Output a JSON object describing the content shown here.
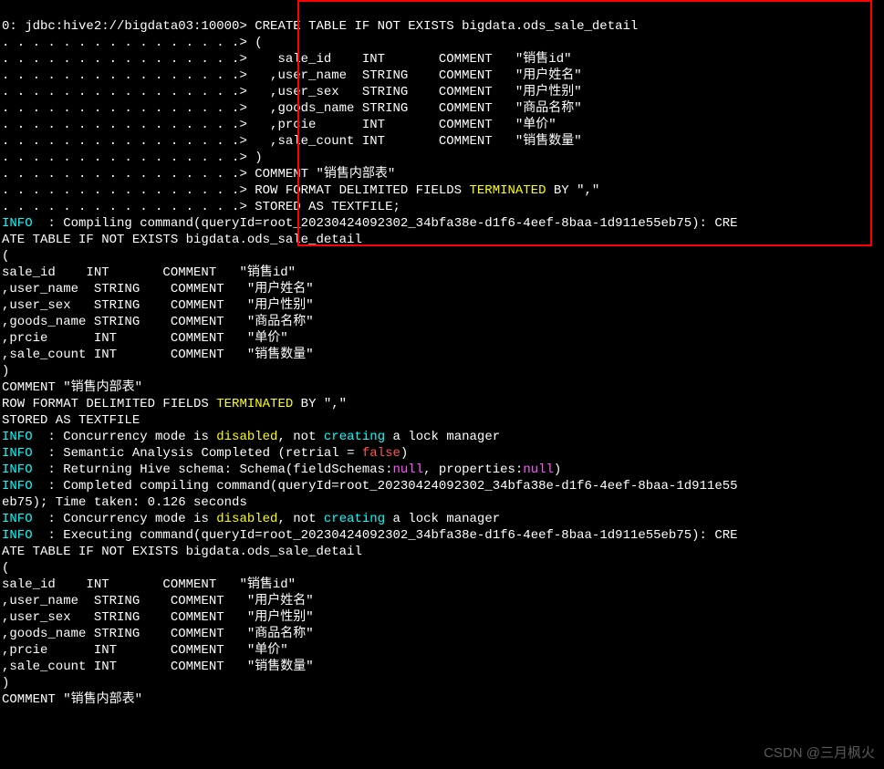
{
  "prompt": "0: jdbc:hive2://bigdata03:10000>",
  "cont": ". . . . . . . . . . . . . . . .>",
  "sql": {
    "line1": " CREATE TABLE IF NOT EXISTS bigdata.ods_sale_detail",
    "line2": " (",
    "line3": "    sale_id    INT       COMMENT   \"销售id\"",
    "line4": "   ,user_name  STRING    COMMENT   \"用户姓名\"",
    "line5": "   ,user_sex   STRING    COMMENT   \"用户性别\"",
    "line6": "   ,goods_name STRING    COMMENT   \"商品名称\"",
    "line7": "   ,prcie      INT       COMMENT   \"单价\"",
    "line8": "   ,sale_count INT       COMMENT   \"销售数量\"",
    "line9": " )",
    "line10": " COMMENT \"销售内部表\"",
    "line11a": " ROW FORMAT DELIMITED FIELDS ",
    "line11b": "TERMINATED",
    "line11c": " BY \",\"",
    "line12": " STORED AS TEXTFILE;"
  },
  "body": {
    "paren_open": "(",
    "col1": "sale_id    INT       COMMENT   \"销售id\"",
    "col2": ",user_name  STRING    COMMENT   \"用户姓名\"",
    "col3": ",user_sex   STRING    COMMENT   \"用户性别\"",
    "col4": ",goods_name STRING    COMMENT   \"商品名称\"",
    "col5": ",prcie      INT       COMMENT   \"单价\"",
    "col6": ",sale_count INT       COMMENT   \"销售数量\"",
    "paren_close": ")",
    "comment_line": "COMMENT \"销售内部表\"",
    "row_a": "ROW FORMAT DELIMITED FIELDS ",
    "row_b": "TERMINATED",
    "row_c": " BY \",\"",
    "stored": "STORED AS TEXTFILE"
  },
  "info": {
    "label": "INFO",
    "sep": "  : ",
    "compiling1": "Compiling command(queryId=root_20230424092302_34bfa38e-d1f6-4eef-8baa-1d911e55eb75): CRE",
    "compiling2": "ATE TABLE IF NOT EXISTS bigdata.ods_sale_detail",
    "conc1a": "Concurrency mode is ",
    "conc1b": "disabled",
    "conc1c": ", not ",
    "conc1d": "creating",
    "conc1e": " a lock manager",
    "sem_a": "Semantic Analysis Completed (retrial = ",
    "sem_b": "false",
    "sem_c": ")",
    "ret_a": "Returning Hive schema: Schema(fieldSchemas:",
    "ret_b": "null",
    "ret_c": ", properties:",
    "ret_d": "null",
    "ret_e": ")",
    "done1": "Completed compiling command(queryId=root_20230424092302_34bfa38e-d1f6-4eef-8baa-1d911e55",
    "done2": "eb75); Time taken: 0.126 seconds",
    "exec1": "Executing command(queryId=root_20230424092302_34bfa38e-d1f6-4eef-8baa-1d911e55eb75): CRE",
    "exec2": "ATE TABLE IF NOT EXISTS bigdata.ods_sale_detail"
  },
  "watermark": "CSDN @三月枫火"
}
